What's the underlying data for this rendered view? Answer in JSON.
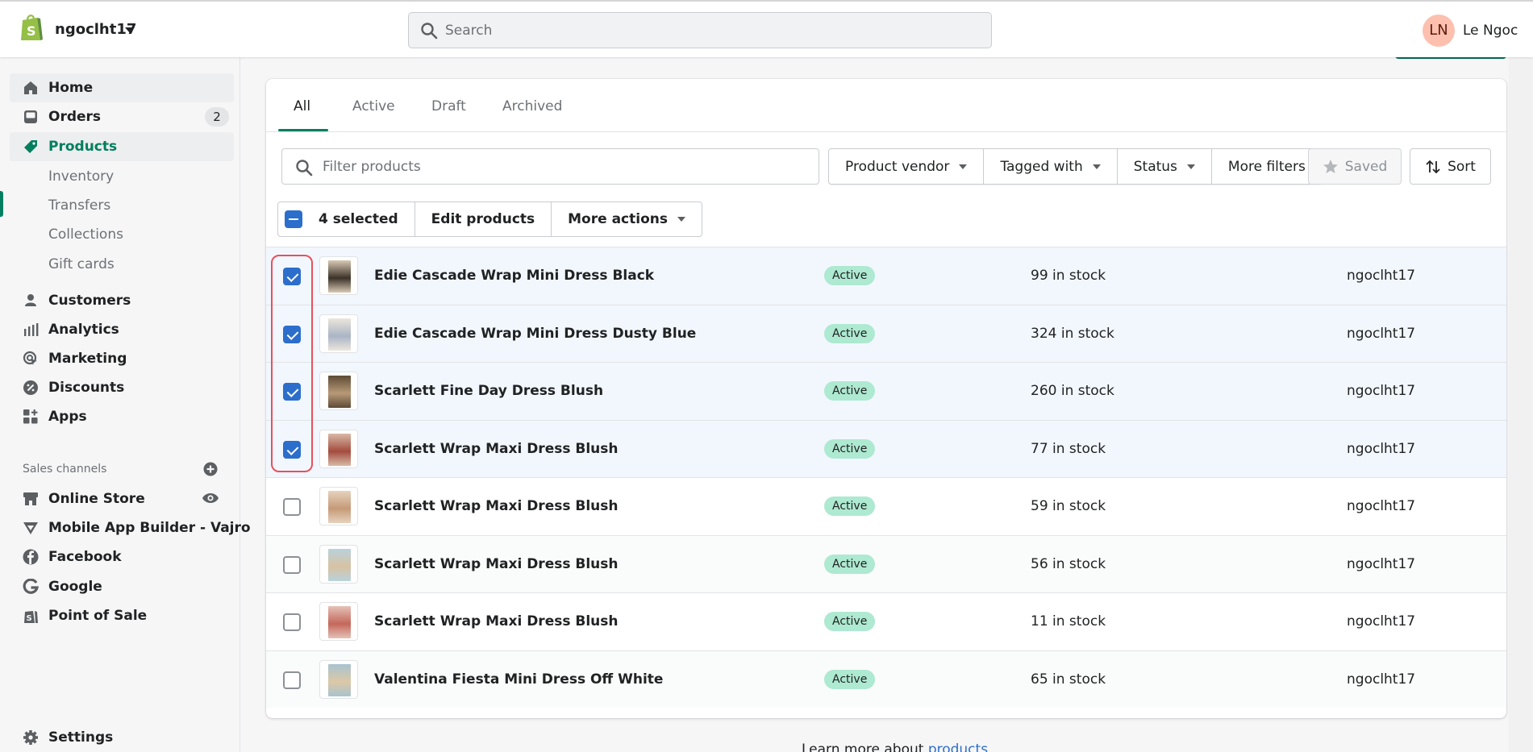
{
  "topbar": {
    "store_name": "ngoclht17",
    "search_placeholder": "Search",
    "user_initials": "LN",
    "user_name": "Le Ngoc"
  },
  "sidebar": {
    "items": [
      {
        "label": "Home",
        "icon": "home-icon"
      },
      {
        "label": "Orders",
        "icon": "orders-icon",
        "badge": "2"
      },
      {
        "label": "Products",
        "icon": "tag-icon",
        "active": true
      },
      {
        "label": "Inventory",
        "sub": true
      },
      {
        "label": "Transfers",
        "sub": true
      },
      {
        "label": "Collections",
        "sub": true
      },
      {
        "label": "Gift cards",
        "sub": true
      },
      {
        "label": "Customers",
        "icon": "person-icon"
      },
      {
        "label": "Analytics",
        "icon": "bar-chart-icon"
      },
      {
        "label": "Marketing",
        "icon": "target-icon"
      },
      {
        "label": "Discounts",
        "icon": "discount-icon"
      },
      {
        "label": "Apps",
        "icon": "apps-icon"
      }
    ],
    "sales_channels_label": "Sales channels",
    "channels": [
      {
        "label": "Online Store",
        "icon": "store-icon"
      },
      {
        "label": "Mobile App Builder - Vajro",
        "icon": "vajro-icon"
      },
      {
        "label": "Facebook",
        "icon": "facebook-icon"
      },
      {
        "label": "Google",
        "icon": "google-icon"
      },
      {
        "label": "Point of Sale",
        "icon": "pos-icon"
      }
    ],
    "settings_label": "Settings"
  },
  "tabs": [
    "All",
    "Active",
    "Draft",
    "Archived"
  ],
  "selected_tab": "All",
  "filters": {
    "placeholder": "Filter products",
    "product_vendor": "Product vendor",
    "tagged_with": "Tagged with",
    "status": "Status",
    "more_filters": "More filters",
    "saved": "Saved",
    "sort": "Sort"
  },
  "bulk": {
    "selected_label": "4 selected",
    "edit_products": "Edit products",
    "more_actions": "More actions"
  },
  "products": [
    {
      "name": "Edie Cascade Wrap Mini Dress Black",
      "status": "Active",
      "stock": "99 in stock",
      "vendor": "ngoclht17",
      "checked": true
    },
    {
      "name": "Edie Cascade Wrap Mini Dress Dusty Blue",
      "status": "Active",
      "stock": "324 in stock",
      "vendor": "ngoclht17",
      "checked": true
    },
    {
      "name": "Scarlett Fine Day Dress Blush",
      "status": "Active",
      "stock": "260 in stock",
      "vendor": "ngoclht17",
      "checked": true
    },
    {
      "name": "Scarlett Wrap Maxi Dress Blush",
      "status": "Active",
      "stock": "77 in stock",
      "vendor": "ngoclht17",
      "checked": true
    },
    {
      "name": "Scarlett Wrap Maxi Dress Blush",
      "status": "Active",
      "stock": "59 in stock",
      "vendor": "ngoclht17",
      "checked": false
    },
    {
      "name": "Scarlett Wrap Maxi Dress Blush",
      "status": "Active",
      "stock": "56 in stock",
      "vendor": "ngoclht17",
      "checked": false
    },
    {
      "name": "Scarlett Wrap Maxi Dress Blush",
      "status": "Active",
      "stock": "11 in stock",
      "vendor": "ngoclht17",
      "checked": false
    },
    {
      "name": "Valentina Fiesta Mini Dress Off White",
      "status": "Active",
      "stock": "65 in stock",
      "vendor": "ngoclht17",
      "checked": false
    }
  ],
  "footer": {
    "text": "Learn more about ",
    "link": "products"
  },
  "colors": {
    "accent": "#008060",
    "checkbox": "#2c6ecb",
    "status_active": "#aee9d1",
    "highlight": "#e8505b"
  }
}
